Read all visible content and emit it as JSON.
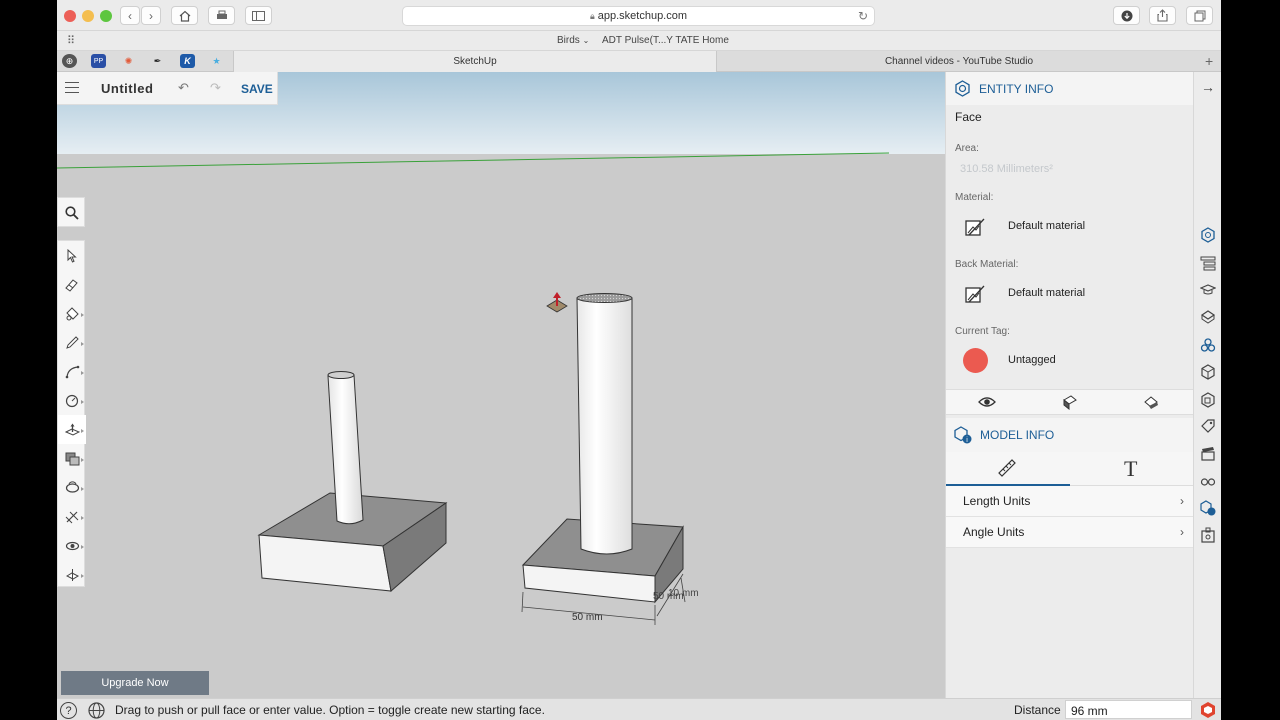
{
  "browser": {
    "url": "app.sketchup.com",
    "favorites": [
      "Birds",
      "ADT Pulse(T...Y TATE Home"
    ],
    "tabs": [
      {
        "label": "SketchUp",
        "active": true
      },
      {
        "label": "Channel videos - YouTube Studio",
        "active": false
      }
    ],
    "new_tab": "+"
  },
  "app": {
    "doc_title": "Untitled",
    "save_label": "SAVE",
    "upgrade_label": "Upgrade Now"
  },
  "toolbox": {
    "search_icon": "search-icon",
    "tools": [
      "select-icon",
      "eraser-icon",
      "paint-bucket-icon",
      "pencil-icon",
      "arc-icon",
      "circle-icon",
      "push-pull-icon",
      "offset-icon",
      "orbit-icon",
      "tape-measure-icon",
      "walk-icon",
      "section-icon"
    ],
    "active_tool": "push-pull-icon"
  },
  "scene": {
    "dim_width": "50 mm",
    "dim_depth": "50 mm",
    "dim_height": "10 mm"
  },
  "entity_info": {
    "title": "ENTITY INFO",
    "entity": "Face",
    "area_label": "Area:",
    "area_value": "310.58 Millimeters²",
    "material_label": "Material:",
    "material_value": "Default material",
    "back_material_label": "Back Material:",
    "back_material_value": "Default material",
    "tag_label": "Current Tag:",
    "tag_value": "Untagged",
    "tag_color": "#eb5a50"
  },
  "model_info": {
    "title": "MODEL INFO",
    "rows": [
      "Length Units",
      "Angle Units"
    ]
  },
  "status": {
    "message": "Drag to push or pull face or enter value. Option = toggle create new starting face.",
    "distance_label": "Distance",
    "distance_value": "96 mm"
  },
  "colors": {
    "accent": "#1d5e96",
    "axis_green": "#3aa13a"
  }
}
